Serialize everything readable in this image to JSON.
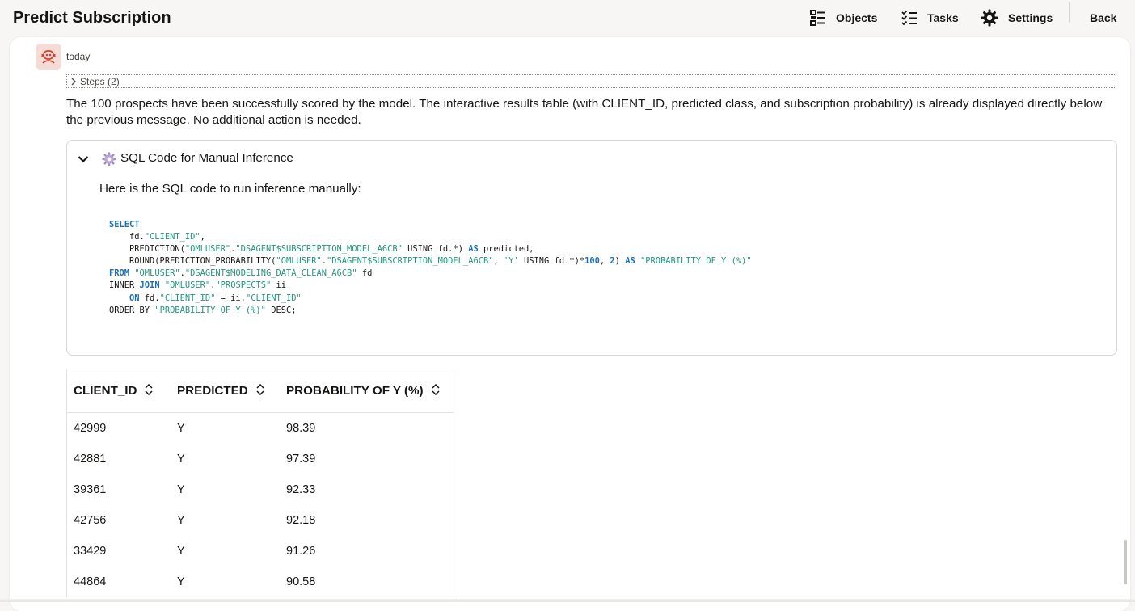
{
  "header": {
    "title": "Predict Subscription",
    "nav": {
      "objects_label": "Objects",
      "tasks_label": "Tasks",
      "settings_label": "Settings",
      "back_label": "Back"
    }
  },
  "message": {
    "avatar_icon": "robot-icon",
    "timestamp": "today",
    "steps_label": "Steps (2)",
    "text": "The 100 prospects have been successfully scored by the model. The interactive results table (with CLIENT_ID, predicted class, and subscription probability) is already displayed directly below the previous message. No additional action is needed."
  },
  "sql_card": {
    "title": "SQL Code for Manual Inference",
    "intro": "Here is the SQL code to run inference manually:",
    "lines": [
      [
        "kw",
        "SELECT"
      ],
      [
        "plain",
        "    fd.",
        "str",
        "\"CLIENT_ID\"",
        "plain",
        ","
      ],
      [
        "plain",
        "    PREDICTION(",
        "str",
        "\"OMLUSER\"",
        "plain",
        ".",
        "str",
        "\"DSAGENT$SUBSCRIPTION_MODEL_A6CB\"",
        "plain",
        " USING fd.*) ",
        "kw",
        "AS",
        "plain",
        " predicted,"
      ],
      [
        "plain",
        "    ROUND(PREDICTION_PROBABILITY(",
        "str",
        "\"OMLUSER\"",
        "plain",
        ".",
        "str",
        "\"DSAGENT$SUBSCRIPTION_MODEL_A6CB\"",
        "plain",
        ", ",
        "str",
        "'Y'",
        "plain",
        " USING fd.*)*",
        "num",
        "100",
        "plain",
        ", ",
        "num",
        "2",
        "plain",
        ") ",
        "kw",
        "AS",
        "plain",
        " ",
        "str",
        "\"PROBABILITY OF Y (%)\""
      ],
      [
        "kw",
        "FROM",
        "plain",
        " ",
        "str",
        "\"OMLUSER\"",
        "plain",
        ".",
        "str",
        "\"DSAGENT$MODELING_DATA_CLEAN_A6CB\"",
        "plain",
        " fd"
      ],
      [
        "plain",
        "INNER ",
        "kw",
        "JOIN",
        "plain",
        " ",
        "str",
        "\"OMLUSER\"",
        "plain",
        ".",
        "str",
        "\"PROSPECTS\"",
        "plain",
        " ii"
      ],
      [
        "plain",
        "    ",
        "kw",
        "ON",
        "plain",
        " fd.",
        "str",
        "\"CLIENT_ID\"",
        "plain",
        " = ii.",
        "str",
        "\"CLIENT_ID\""
      ],
      [
        "plain",
        "ORDER BY ",
        "str",
        "\"PROBABILITY OF Y (%)\"",
        "plain",
        " DESC;"
      ]
    ]
  },
  "results": {
    "columns": [
      "CLIENT_ID",
      "PREDICTED",
      "PROBABILITY OF Y (%)"
    ],
    "rows": [
      [
        "42999",
        "Y",
        "98.39"
      ],
      [
        "42881",
        "Y",
        "97.39"
      ],
      [
        "39361",
        "Y",
        "92.33"
      ],
      [
        "42756",
        "Y",
        "92.18"
      ],
      [
        "33429",
        "Y",
        "91.26"
      ],
      [
        "44864",
        "Y",
        "90.58"
      ]
    ]
  },
  "colors": {
    "avatar_bg": "#f5dbd6",
    "avatar_icon": "#c74634",
    "sql_keyword": "#1a6fb5",
    "sql_string": "#21957f"
  }
}
